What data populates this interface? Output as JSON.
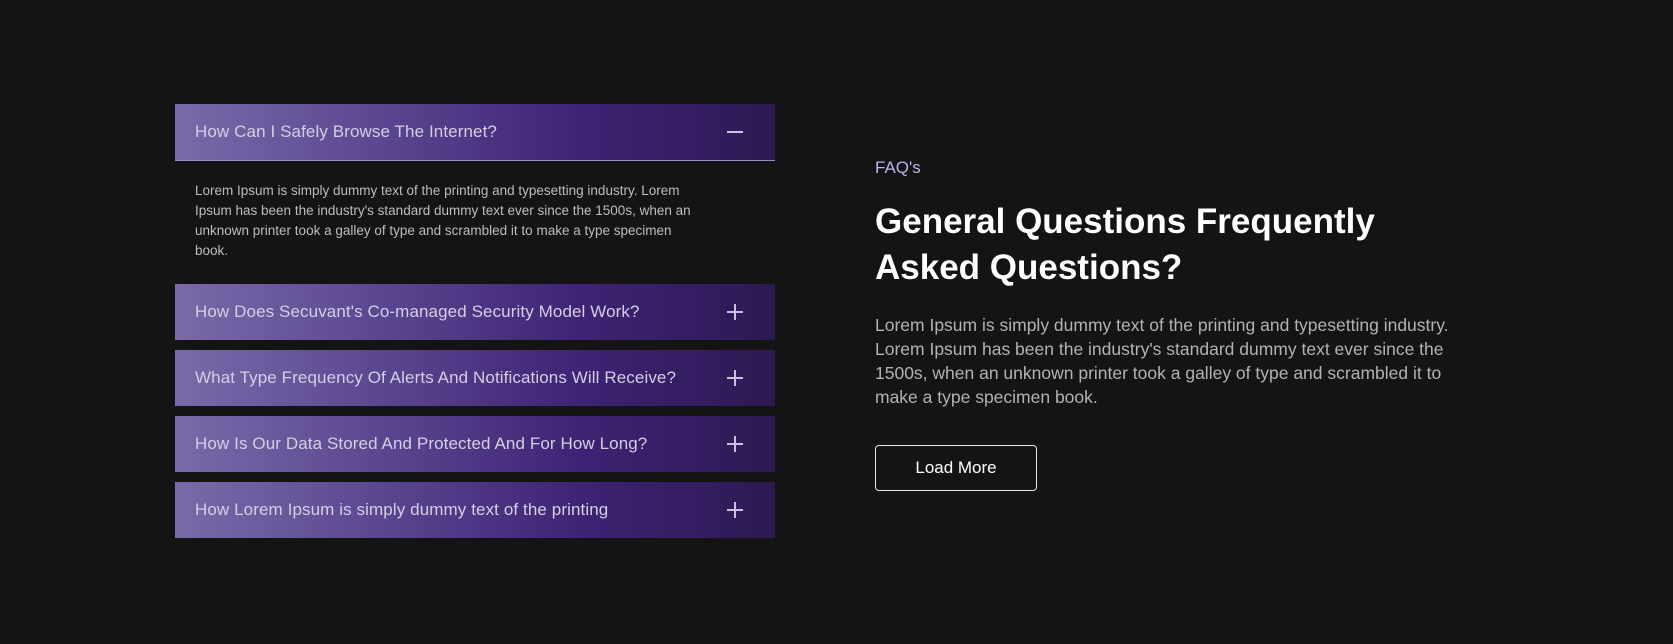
{
  "faq": {
    "items": [
      {
        "question": "How Can I Safely Browse The Internet?",
        "answer": "Lorem Ipsum is simply dummy text of the printing and typesetting industry. Lorem Ipsum has been the industry's standard dummy text ever since the 1500s, when an unknown printer took a galley of type and scrambled it to make a type specimen book.",
        "expanded": true,
        "icon": "minus-icon"
      },
      {
        "question": "How Does Secuvant's Co-managed Security Model Work?",
        "expanded": false,
        "icon": "plus-icon"
      },
      {
        "question": "What Type Frequency Of Alerts And Notifications Will Receive?",
        "expanded": false,
        "icon": "plus-icon"
      },
      {
        "question": "How Is Our Data Stored And Protected And For How Long?",
        "expanded": false,
        "icon": "plus-icon"
      },
      {
        "question": "How Lorem Ipsum is simply dummy text of the printing",
        "expanded": false,
        "icon": "plus-icon"
      }
    ]
  },
  "intro": {
    "eyebrow": "FAQ's",
    "title_line1": "General Questions Frequently",
    "title_line2": "Asked Questions?",
    "description": "Lorem Ipsum is simply dummy text of the printing and typesetting industry. Lorem Ipsum has been the industry's standard dummy text ever since the 1500s, when an unknown printer took a galley of type and scrambled it to make a type specimen book.",
    "button_label": "Load More"
  },
  "colors": {
    "background": "#141414",
    "accent": "#b9b6ec",
    "header_gradient_start": "#7a6aa8",
    "header_gradient_end": "#2c1a52"
  }
}
